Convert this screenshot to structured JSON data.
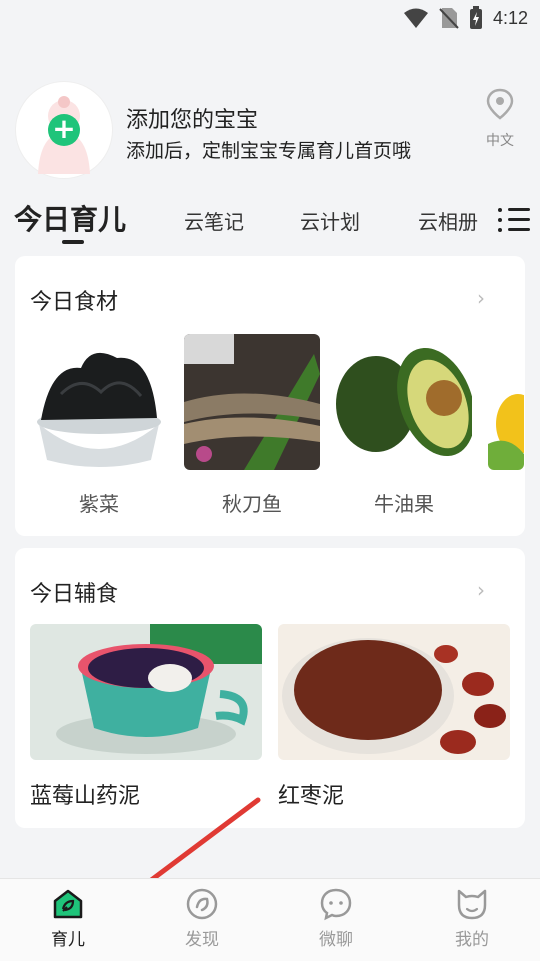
{
  "status": {
    "time": "4:12"
  },
  "profile": {
    "title": "添加您的宝宝",
    "subtitle": "添加后，定制宝宝专属育儿首页哦",
    "language": "中文"
  },
  "tabs": {
    "active": "今日育儿",
    "items": [
      "云笔记",
      "云计划",
      "云相册"
    ]
  },
  "ingredients": {
    "title": "今日食材",
    "more": "›",
    "items": [
      {
        "name": "紫菜"
      },
      {
        "name": "秋刀鱼"
      },
      {
        "name": "牛油果"
      }
    ]
  },
  "complementary": {
    "title": "今日辅食",
    "more": "›",
    "items": [
      {
        "name": "蓝莓山药泥"
      },
      {
        "name": "红枣泥"
      }
    ]
  },
  "bottom_nav": {
    "items": [
      {
        "label": "育儿",
        "icon": "home-leaf-icon"
      },
      {
        "label": "发现",
        "icon": "compass-icon"
      },
      {
        "label": "微聊",
        "icon": "chat-icon"
      },
      {
        "label": "我的",
        "icon": "cat-face-icon"
      }
    ]
  },
  "colors": {
    "accent": "#1fc47a",
    "arrow": "#e03a34"
  }
}
